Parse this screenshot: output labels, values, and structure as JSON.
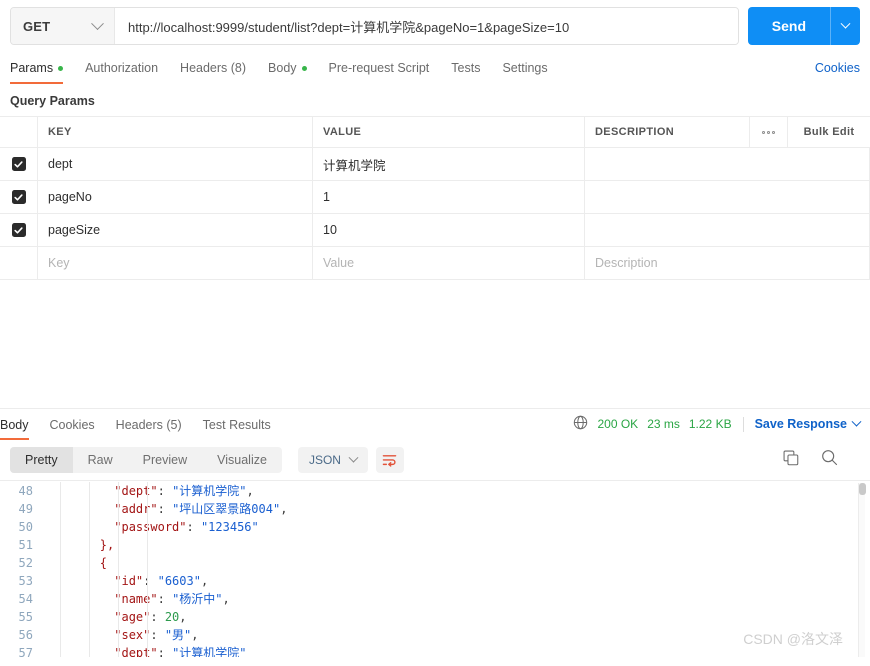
{
  "request": {
    "method": "GET",
    "url": "http://localhost:9999/student/list?dept=计算机学院&pageNo=1&pageSize=10",
    "send_label": "Send",
    "tabs": [
      {
        "label": "Params",
        "has_dot": true,
        "active": true
      },
      {
        "label": "Authorization",
        "has_dot": false,
        "active": false
      },
      {
        "label": "Headers (8)",
        "has_dot": false,
        "active": false
      },
      {
        "label": "Body",
        "has_dot": true,
        "active": false
      },
      {
        "label": "Pre-request Script",
        "has_dot": false,
        "active": false
      },
      {
        "label": "Tests",
        "has_dot": false,
        "active": false
      },
      {
        "label": "Settings",
        "has_dot": false,
        "active": false
      }
    ],
    "cookies_link": "Cookies"
  },
  "query_params": {
    "section_title": "Query Params",
    "columns": {
      "key": "KEY",
      "value": "VALUE",
      "description": "DESCRIPTION"
    },
    "bulk_edit_label": "Bulk Edit",
    "rows": [
      {
        "checked": true,
        "key": "dept",
        "value": "计算机学院",
        "description": ""
      },
      {
        "checked": true,
        "key": "pageNo",
        "value": "1",
        "description": ""
      },
      {
        "checked": true,
        "key": "pageSize",
        "value": "10",
        "description": ""
      }
    ],
    "placeholder_row": {
      "key": "Key",
      "value": "Value",
      "description": "Description"
    }
  },
  "response": {
    "tabs": [
      {
        "label": "Body",
        "active": true
      },
      {
        "label": "Cookies",
        "active": false
      },
      {
        "label": "Headers (5)",
        "active": false
      },
      {
        "label": "Test Results",
        "active": false
      }
    ],
    "status": "200 OK",
    "time": "23 ms",
    "size": "1.22 KB",
    "save_response_label": "Save Response",
    "view_modes": [
      {
        "label": "Pretty",
        "active": true
      },
      {
        "label": "Raw",
        "active": false
      },
      {
        "label": "Preview",
        "active": false
      },
      {
        "label": "Visualize",
        "active": false
      }
    ],
    "format": "JSON",
    "body_lines": [
      {
        "n": "48",
        "indent": 5,
        "segments": [
          {
            "t": "key",
            "s": "\"dept\""
          },
          {
            "t": "p",
            "s": ": "
          },
          {
            "t": "str",
            "s": "\"计算机学院\""
          },
          {
            "t": "p",
            "s": ","
          }
        ]
      },
      {
        "n": "49",
        "indent": 5,
        "segments": [
          {
            "t": "key",
            "s": "\"addr\""
          },
          {
            "t": "p",
            "s": ": "
          },
          {
            "t": "str",
            "s": "\"坪山区翠景路004\""
          },
          {
            "t": "p",
            "s": ","
          }
        ]
      },
      {
        "n": "50",
        "indent": 5,
        "segments": [
          {
            "t": "key",
            "s": "\"password\""
          },
          {
            "t": "p",
            "s": ": "
          },
          {
            "t": "str",
            "s": "\"123456\""
          }
        ]
      },
      {
        "n": "51",
        "indent": 4,
        "segments": [
          {
            "t": "key",
            "s": "},"
          }
        ]
      },
      {
        "n": "52",
        "indent": 4,
        "segments": [
          {
            "t": "key",
            "s": "{"
          }
        ]
      },
      {
        "n": "53",
        "indent": 5,
        "segments": [
          {
            "t": "key",
            "s": "\"id\""
          },
          {
            "t": "p",
            "s": ": "
          },
          {
            "t": "str",
            "s": "\"6603\""
          },
          {
            "t": "p",
            "s": ","
          }
        ]
      },
      {
        "n": "54",
        "indent": 5,
        "segments": [
          {
            "t": "key",
            "s": "\"name\""
          },
          {
            "t": "p",
            "s": ": "
          },
          {
            "t": "str",
            "s": "\"杨沂中\""
          },
          {
            "t": "p",
            "s": ","
          }
        ]
      },
      {
        "n": "55",
        "indent": 5,
        "segments": [
          {
            "t": "key",
            "s": "\"age\""
          },
          {
            "t": "p",
            "s": ": "
          },
          {
            "t": "num",
            "s": "20"
          },
          {
            "t": "p",
            "s": ","
          }
        ]
      },
      {
        "n": "56",
        "indent": 5,
        "segments": [
          {
            "t": "key",
            "s": "\"sex\""
          },
          {
            "t": "p",
            "s": ": "
          },
          {
            "t": "str",
            "s": "\"男\""
          },
          {
            "t": "p",
            "s": ","
          }
        ]
      },
      {
        "n": "57",
        "indent": 5,
        "segments": [
          {
            "t": "key",
            "s": "\"dept\""
          },
          {
            "t": "p",
            "s": ": "
          },
          {
            "t": "str",
            "s": "\"计算机学院\""
          }
        ]
      }
    ]
  },
  "watermark": "CSDN @洛文泽",
  "colors": {
    "accent_orange": "#f26b3a",
    "send_blue": "#0f8ef5",
    "link_blue": "#0f62c9",
    "status_green": "#2aa544",
    "dot_green": "#38b54a"
  }
}
